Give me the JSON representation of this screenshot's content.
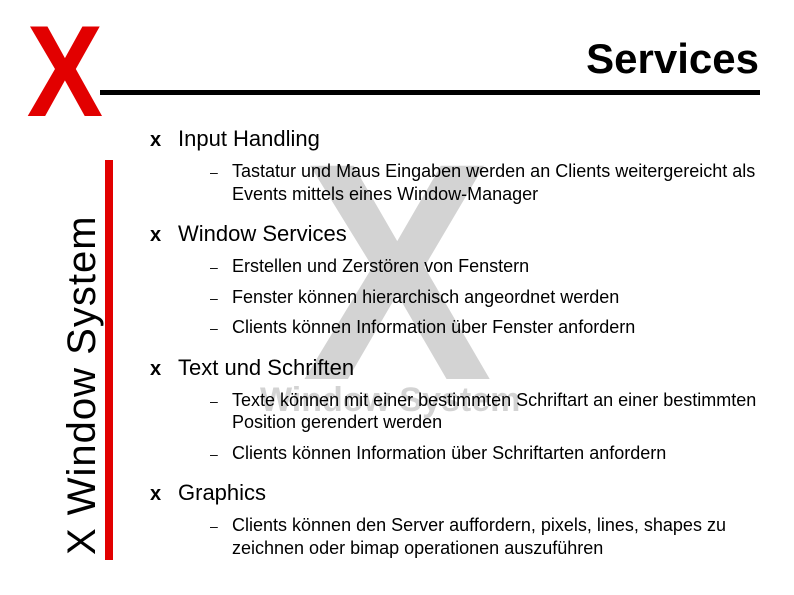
{
  "logo": "X",
  "title": "Services",
  "side_label": "X Window System",
  "watermark": {
    "x": "X",
    "text": "Window System"
  },
  "bullet_char": "x",
  "dash_char": "–",
  "sections": [
    {
      "heading": "Input Handling",
      "items": [
        "Tastatur und Maus Eingaben werden an Clients weitergereicht als Events mittels eines Window-Manager"
      ]
    },
    {
      "heading": "Window Services",
      "items": [
        "Erstellen und Zerstören von Fenstern",
        "Fenster können hierarchisch angeordnet werden",
        "Clients können Information über Fenster anfordern"
      ]
    },
    {
      "heading": "Text und Schriften",
      "items": [
        "Texte können mit einer bestimmten Schriftart an einer bestimmten Position gerendert werden",
        "Clients können Information über Schriftarten anfordern"
      ]
    },
    {
      "heading": "Graphics",
      "items": [
        "Clients können den Server auffordern, pixels, lines, shapes zu zeichnen oder bimap operationen auszuführen"
      ]
    }
  ]
}
